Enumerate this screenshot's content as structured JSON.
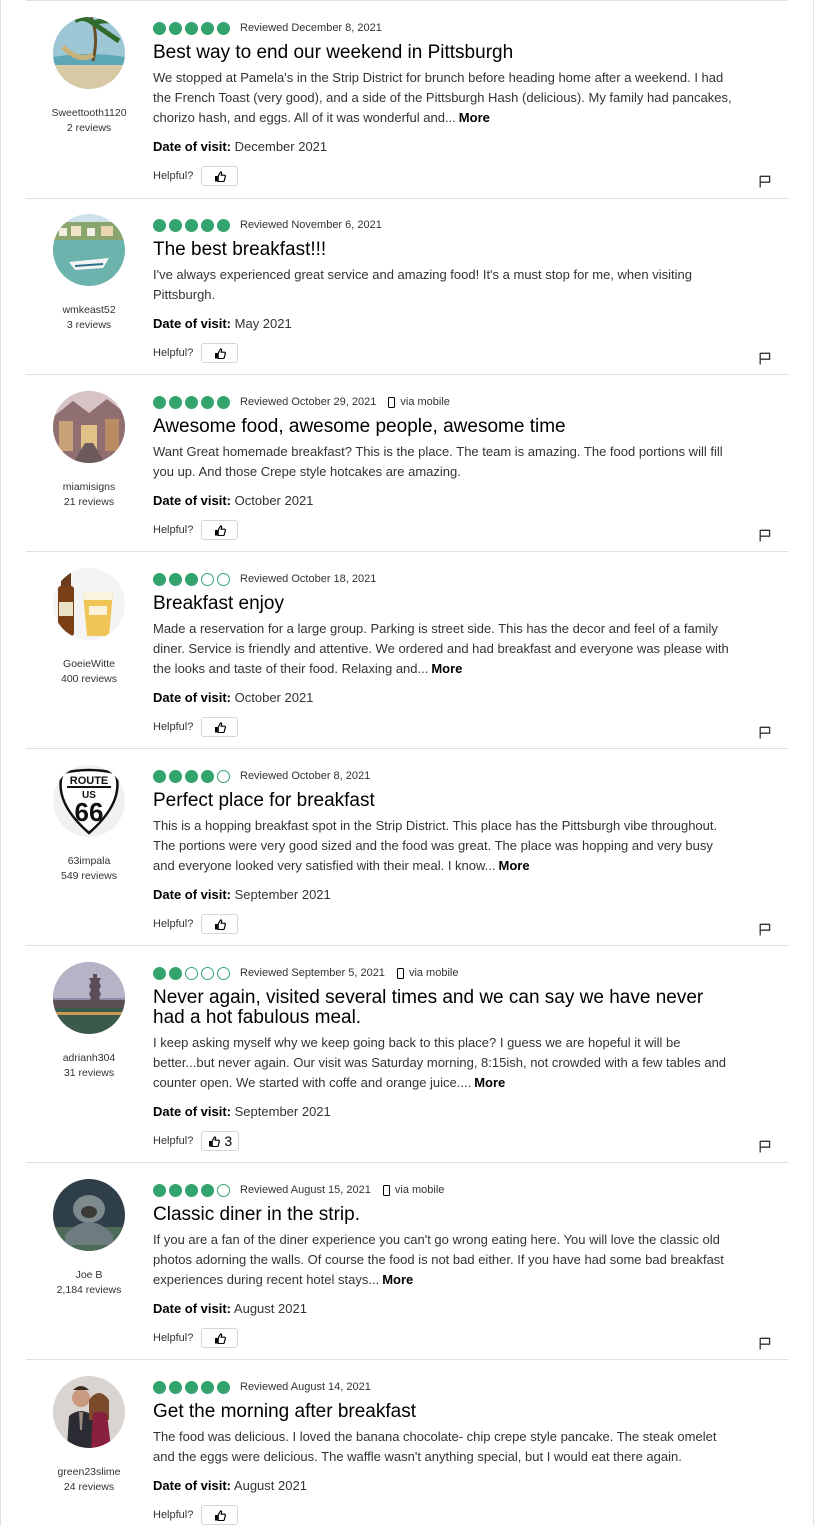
{
  "colors": {
    "bubble": "#34a46e",
    "divider": "#e0e0e0"
  },
  "labels": {
    "date_of_visit": "Date of visit:",
    "helpful": "Helpful?",
    "more": "More",
    "via_mobile": "via mobile"
  },
  "reviews": [
    {
      "user": "Sweettooth1120",
      "review_count": "2 reviews",
      "rating": 5,
      "reviewed": "Reviewed December 8, 2021",
      "mobile": false,
      "title": "Best way to end our weekend in Pittsburgh",
      "text": "We stopped at Pamela's in the Strip District for brunch before heading home after a weekend. I had the French Toast (very good), and a side of the Pittsburgh Hash (delicious). My family had pancakes, chorizo hash, and eggs. All of it was wonderful and...",
      "more": true,
      "date_of_visit": "December 2021",
      "helpful_votes": "",
      "avatar_icon": "hammock-beach-icon"
    },
    {
      "user": "wmkeast52",
      "review_count": "3 reviews",
      "rating": 5,
      "reviewed": "Reviewed November 6, 2021",
      "mobile": false,
      "title": "The best breakfast!!!",
      "text": "I've always experienced great service and amazing food! It's a must stop for me, when visiting Pittsburgh.",
      "more": false,
      "date_of_visit": "May 2021",
      "helpful_votes": "",
      "avatar_icon": "boat-harbor-icon"
    },
    {
      "user": "miamisigns",
      "review_count": "21 reviews",
      "rating": 5,
      "reviewed": "Reviewed October 29, 2021",
      "mobile": true,
      "title": "Awesome food, awesome people, awesome time",
      "text": "Want Great homemade breakfast? This is the place. The team is amazing. The food portions will fill you up. And those Crepe style hotcakes are amazing.",
      "more": false,
      "date_of_visit": "October 2021",
      "helpful_votes": "",
      "avatar_icon": "town-street-icon"
    },
    {
      "user": "GoeieWitte",
      "review_count": "400 reviews",
      "rating": 3,
      "reviewed": "Reviewed October 18, 2021",
      "mobile": false,
      "title": "Breakfast enjoy",
      "text": "Made a reservation for a large group. Parking is street side. This has the decor and feel of a family diner. Service is friendly and attentive. We ordered and had breakfast and everyone was please with the looks and taste of their food. Relaxing and...",
      "more": true,
      "date_of_visit": "October 2021",
      "helpful_votes": "",
      "avatar_icon": "beer-glass-icon"
    },
    {
      "user": "63impala",
      "review_count": "549 reviews",
      "rating": 4,
      "reviewed": "Reviewed October 8, 2021",
      "mobile": false,
      "title": "Perfect place for breakfast",
      "text": "This is a hopping breakfast spot in the Strip District. This place has the Pittsburgh vibe throughout. The portions were very good sized and the food was great. The place was hopping and very busy and everyone looked very satisfied with their meal. I know...",
      "more": true,
      "date_of_visit": "September 2021",
      "helpful_votes": "",
      "avatar_icon": "route-66-sign-icon",
      "sign": {
        "top": "ROUTE",
        "mid": "US",
        "num": "66"
      }
    },
    {
      "user": "adrianh304",
      "review_count": "31 reviews",
      "rating": 2,
      "reviewed": "Reviewed September 5, 2021",
      "mobile": true,
      "title": "Never again, visited several times and we can say we have never had a hot fabulous meal.",
      "text": "I keep asking myself why we keep going back to this place? I guess we are hopeful it will be better...but never again. Our visit was Saturday morning, 8:15ish, not crowded with a few tables and counter open. We started with coffe and orange juice....",
      "more": true,
      "date_of_visit": "September 2021",
      "helpful_votes": "3",
      "avatar_icon": "pagoda-skyline-icon"
    },
    {
      "user": "Joe B",
      "review_count": "2,184 reviews",
      "rating": 4,
      "reviewed": "Reviewed August 15, 2021",
      "mobile": true,
      "title": "Classic diner in the strip.",
      "text": "If you are a fan of the diner experience you can't go wrong eating here. You will love the classic old photos adorning the walls. Of course the food is not bad either. If you have had some bad breakfast experiences during recent hotel stays...",
      "more": true,
      "date_of_visit": "August 2021",
      "helpful_votes": "",
      "avatar_icon": "gorilla-icon"
    },
    {
      "user": "green23slime",
      "review_count": "24 reviews",
      "rating": 5,
      "reviewed": "Reviewed August 14, 2021",
      "mobile": false,
      "title": "Get the morning after breakfast",
      "text": "The food was delicious. I loved the banana chocolate- chip crepe style pancake. The steak omelet and the eggs were delicious. The waffle wasn't anything special, but I would eat there again.",
      "more": false,
      "date_of_visit": "August 2021",
      "helpful_votes": "",
      "avatar_icon": "couple-photo-icon"
    }
  ]
}
